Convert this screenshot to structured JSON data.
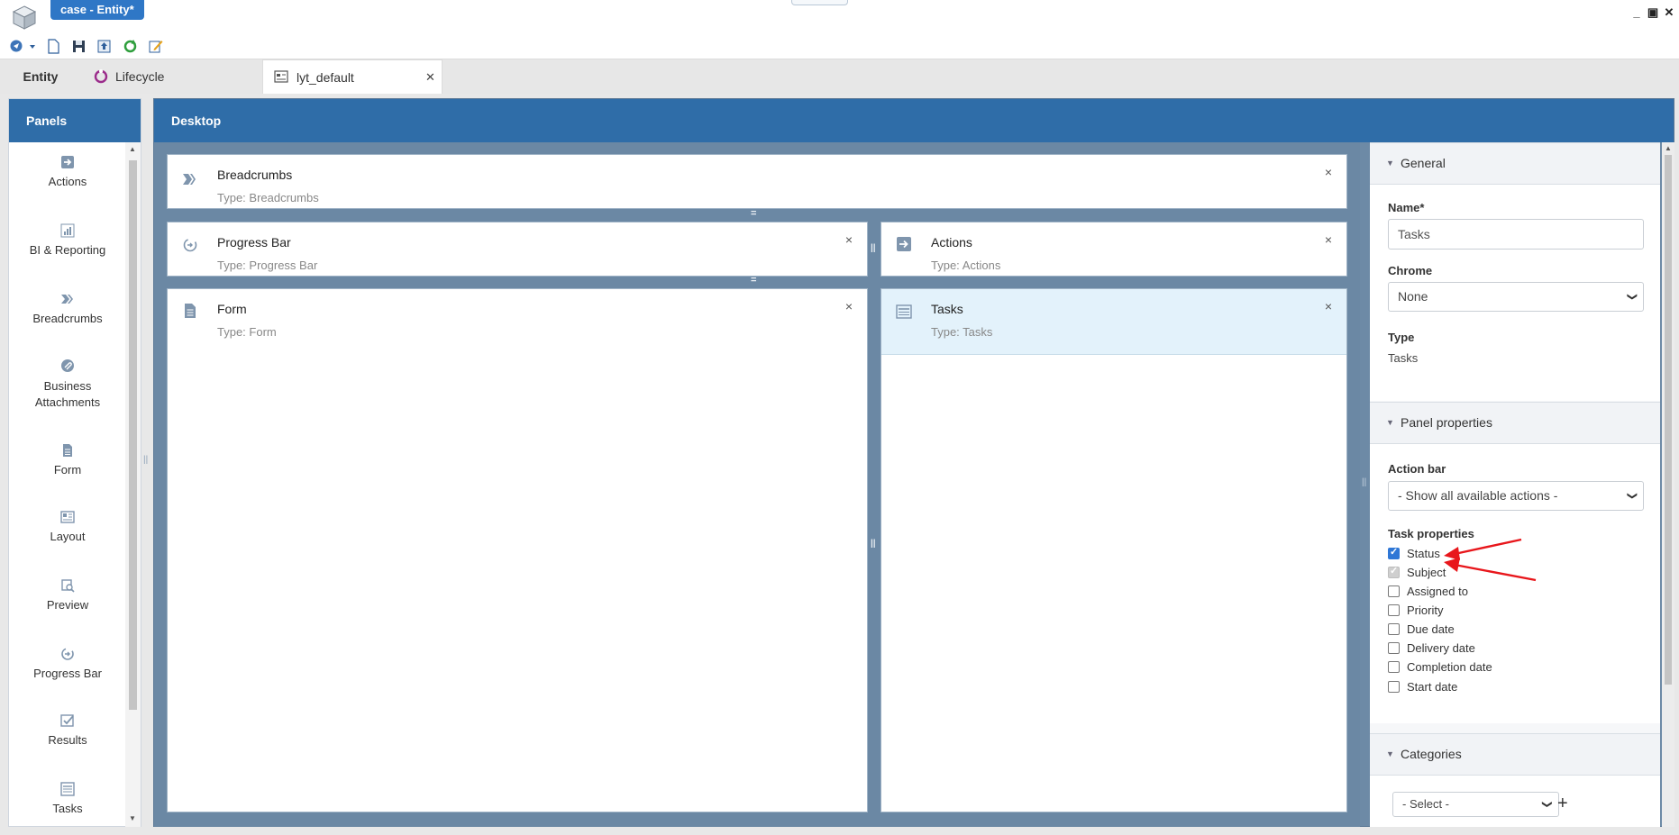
{
  "window": {
    "title": "case - Entity*",
    "minimize": "_",
    "restore": "▣",
    "close": "✕"
  },
  "toolbar": {
    "icons": [
      "navigate-icon",
      "dropdown-icon",
      "new-document-icon",
      "save-icon",
      "publish-icon",
      "refresh-icon",
      "edit-icon"
    ]
  },
  "tabs": [
    {
      "label": "Entity"
    },
    {
      "label": "Lifecycle"
    },
    {
      "label": "lyt_default",
      "close": "✕"
    }
  ],
  "panels": {
    "header": "Panels",
    "items": [
      {
        "label": "Actions"
      },
      {
        "label": "BI & Reporting"
      },
      {
        "label": "Breadcrumbs"
      },
      {
        "label": "Business Attachments"
      },
      {
        "label": "Form"
      },
      {
        "label": "Layout"
      },
      {
        "label": "Preview"
      },
      {
        "label": "Progress Bar"
      },
      {
        "label": "Results"
      },
      {
        "label": "Tasks"
      }
    ]
  },
  "desktop": {
    "header": "Desktop",
    "widgets": [
      {
        "title": "Breadcrumbs",
        "type": "Type: Breadcrumbs",
        "close": "×"
      },
      {
        "title": "Progress Bar",
        "type": "Type: Progress Bar",
        "close": "×"
      },
      {
        "title": "Actions",
        "type": "Type: Actions",
        "close": "×"
      },
      {
        "title": "Form",
        "type": "Type: Form",
        "close": "×"
      },
      {
        "title": "Tasks",
        "type": "Type: Tasks",
        "close": "×"
      }
    ]
  },
  "properties": {
    "general": {
      "header": "General",
      "name_label": "Name*",
      "name_value": "Tasks",
      "chrome_label": "Chrome",
      "chrome_value": "None",
      "type_label": "Type",
      "type_value": "Tasks"
    },
    "panel_properties": {
      "header": "Panel properties",
      "action_bar_label": "Action bar",
      "action_bar_value": "- Show all available actions -",
      "task_properties_label": "Task properties",
      "task_properties": [
        {
          "label": "Status",
          "checked": true,
          "disabled": false
        },
        {
          "label": "Subject",
          "checked": true,
          "disabled": true
        },
        {
          "label": "Assigned to",
          "checked": false,
          "disabled": false
        },
        {
          "label": "Priority",
          "checked": false,
          "disabled": false
        },
        {
          "label": "Due date",
          "checked": false,
          "disabled": false
        },
        {
          "label": "Delivery date",
          "checked": false,
          "disabled": false
        },
        {
          "label": "Completion date",
          "checked": false,
          "disabled": false
        },
        {
          "label": "Start date",
          "checked": false,
          "disabled": false
        }
      ]
    },
    "categories": {
      "header": "Categories",
      "select_value": "- Select -",
      "add": "+"
    }
  },
  "colors": {
    "header_blue": "#2f6da8",
    "title_badge": "#2f77c6",
    "desktop_bg": "#6b88a4",
    "selected_widget": "#e3f2fb",
    "annotation_arrow": "#e8161b"
  }
}
